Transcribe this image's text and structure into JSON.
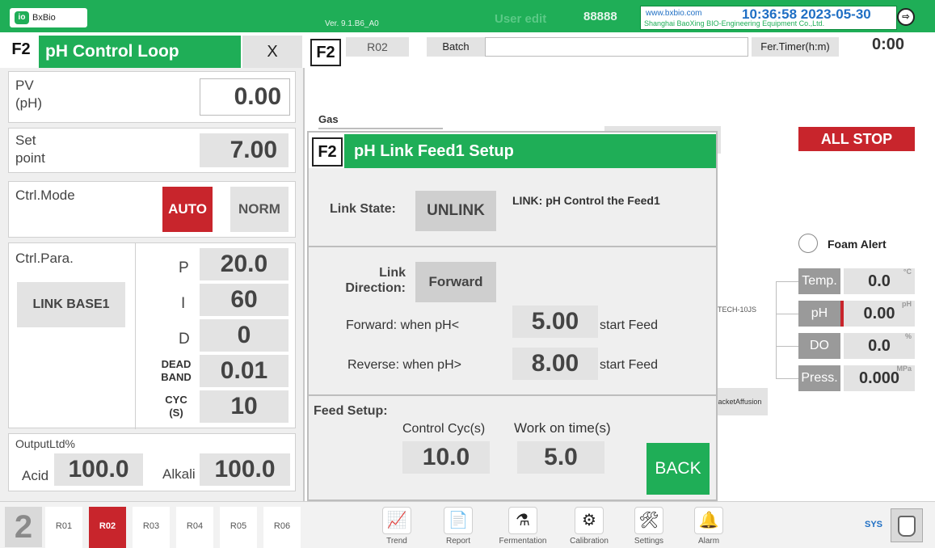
{
  "topbar": {
    "logo_text": "BxBio",
    "version": "Ver. 9.1.B6_A0",
    "user_edit": "User edit",
    "user_id": "88888",
    "website": "www.bxbio.com",
    "company": "Shanghai BaoXing BIO-Engineering Equipment Co.,Ltd.",
    "datetime": "10:36:58 2023-05-30",
    "exit_icon": "exit-icon"
  },
  "left_panel": {
    "tag": "F2",
    "title": "pH Control Loop",
    "close_label": "X",
    "pv": {
      "label_line1": "PV",
      "label_line2": "(pH)",
      "value": "0.00"
    },
    "setpoint": {
      "label_line1": "Set",
      "label_line2": "point",
      "value": "7.00"
    },
    "ctrl_mode": {
      "label": "Ctrl.Mode",
      "auto_label": "AUTO",
      "norm_label": "NORM"
    },
    "ctrl_para": {
      "label": "Ctrl.Para.",
      "link_base_label": "LINK BASE1",
      "p": {
        "label": "P",
        "value": "20.0"
      },
      "i": {
        "label": "I",
        "value": "60"
      },
      "d": {
        "label": "D",
        "value": "0"
      },
      "dead_band": {
        "label_line1": "DEAD",
        "label_line2": "BAND",
        "value": "0.01"
      },
      "cyc": {
        "label_line1": "CYC",
        "label_line2": "(S)",
        "value": "10"
      }
    },
    "output": {
      "label": "OutputLtd%",
      "acid_label": "Acid",
      "acid_value": "100.0",
      "alkali_label": "Alkali",
      "alkali_value": "100.0"
    }
  },
  "right_panel": {
    "tag": "F2",
    "reactor_tab": "R02",
    "batch_label": "Batch",
    "batch_value": "",
    "fer_timer_label": "Fer.Timer(h:m)",
    "fer_timer_value": "0:00",
    "gas_label": "Gas",
    "all_stop_label": "ALL STOP",
    "foam_alert_label": "Foam Alert",
    "tech_label": "TECH-10JS",
    "jacket_label": "JacketAffusion",
    "sensors": [
      {
        "label": "Temp.",
        "value": "0.0",
        "unit": "°C"
      },
      {
        "label": "pH",
        "value": "0.00",
        "unit": "pH"
      },
      {
        "label": "DO",
        "value": "0.0",
        "unit": "%"
      },
      {
        "label": "Press.",
        "value": "0.000",
        "unit": "MPa"
      }
    ]
  },
  "modal": {
    "tag": "F2",
    "title": "pH Link Feed1 Setup",
    "link_state_label": "Link State:",
    "link_state_value": "UNLINK",
    "link_desc": "LINK: pH Control the Feed1",
    "link_direction_line1": "Link",
    "link_direction_line2": "Direction:",
    "link_direction_value": "Forward",
    "forward_label": "Forward: when pH<",
    "forward_value": "5.00",
    "forward_suffix": "start Feed",
    "reverse_label": "Reverse: when pH>",
    "reverse_value": "8.00",
    "reverse_suffix": "start Feed",
    "feed_setup_label": "Feed Setup:",
    "control_cyc_label": "Control Cyc(s)",
    "control_cyc_value": "10.0",
    "work_on_time_label": "Work on time(s)",
    "work_on_time_value": "5.0",
    "back_label": "BACK"
  },
  "bottombar": {
    "unit_number": "2",
    "reactor_tabs": [
      "R01",
      "R02",
      "R03",
      "R04",
      "R05",
      "R06"
    ],
    "active_reactor": "R02",
    "nav": [
      {
        "label": "Trend",
        "icon": "trend-icon",
        "glyph": "📈"
      },
      {
        "label": "Report",
        "icon": "report-icon",
        "glyph": "📄"
      },
      {
        "label": "Fermentation",
        "icon": "fermentation-icon",
        "glyph": "⚗"
      },
      {
        "label": "Calibration",
        "icon": "calibration-icon",
        "glyph": "⚙"
      },
      {
        "label": "Settings",
        "icon": "settings-icon",
        "glyph": "🛠"
      },
      {
        "label": "Alarm",
        "icon": "alarm-icon",
        "glyph": "🔔"
      }
    ],
    "sys_label": "SYS"
  },
  "colors": {
    "accent_green": "#1fae57",
    "alert_red": "#c8252c",
    "link_blue": "#1f6fc4"
  }
}
